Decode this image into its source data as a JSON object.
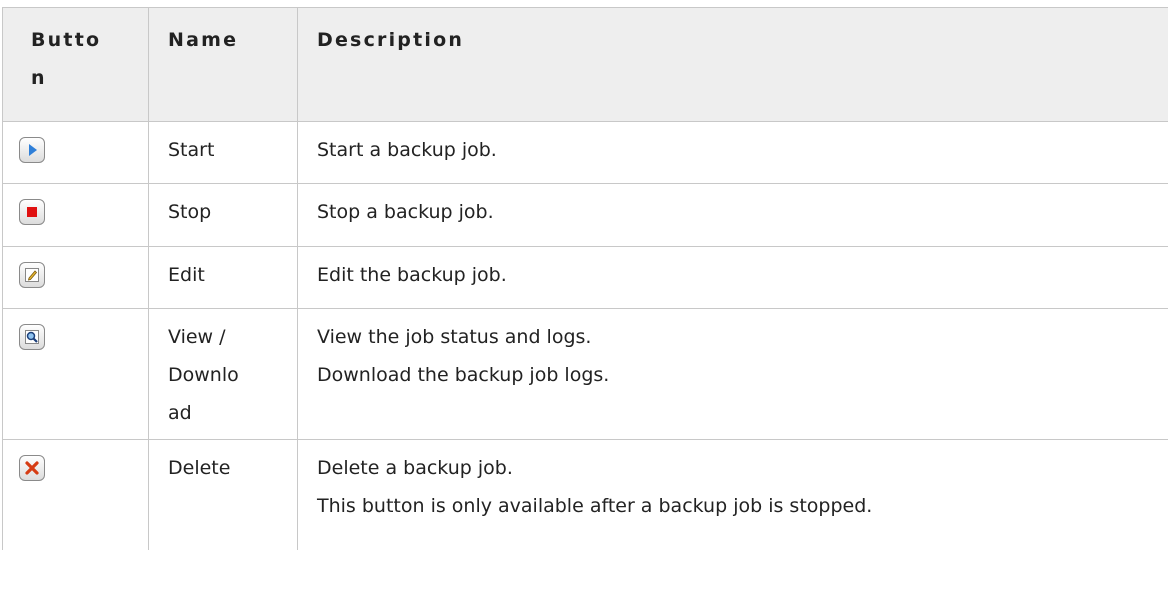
{
  "headers": {
    "button": [
      "Butto",
      "n"
    ],
    "name": "Name",
    "description": "Description"
  },
  "rows": [
    {
      "icon": "play-icon",
      "name": [
        "Start"
      ],
      "description": [
        "Start a backup job."
      ]
    },
    {
      "icon": "stop-icon",
      "name": [
        "Stop"
      ],
      "description": [
        "Stop a backup job."
      ]
    },
    {
      "icon": "edit-icon",
      "name": [
        "Edit"
      ],
      "description": [
        "Edit the backup job."
      ]
    },
    {
      "icon": "magnifier-icon",
      "name": [
        "View /",
        "Downlo",
        "ad"
      ],
      "description": [
        "View the job status and logs.",
        "Download the backup job logs."
      ]
    },
    {
      "icon": "delete-icon",
      "name": [
        "Delete"
      ],
      "description": [
        "Delete a backup job.",
        "This button is only available after a backup job is stopped."
      ]
    }
  ],
  "colors": {
    "border": "#c8c8c8",
    "header_bg": "#eeeeee",
    "play_blue": "#2f7fd8",
    "stop_red": "#e01010",
    "delete_red": "#d63c14"
  }
}
